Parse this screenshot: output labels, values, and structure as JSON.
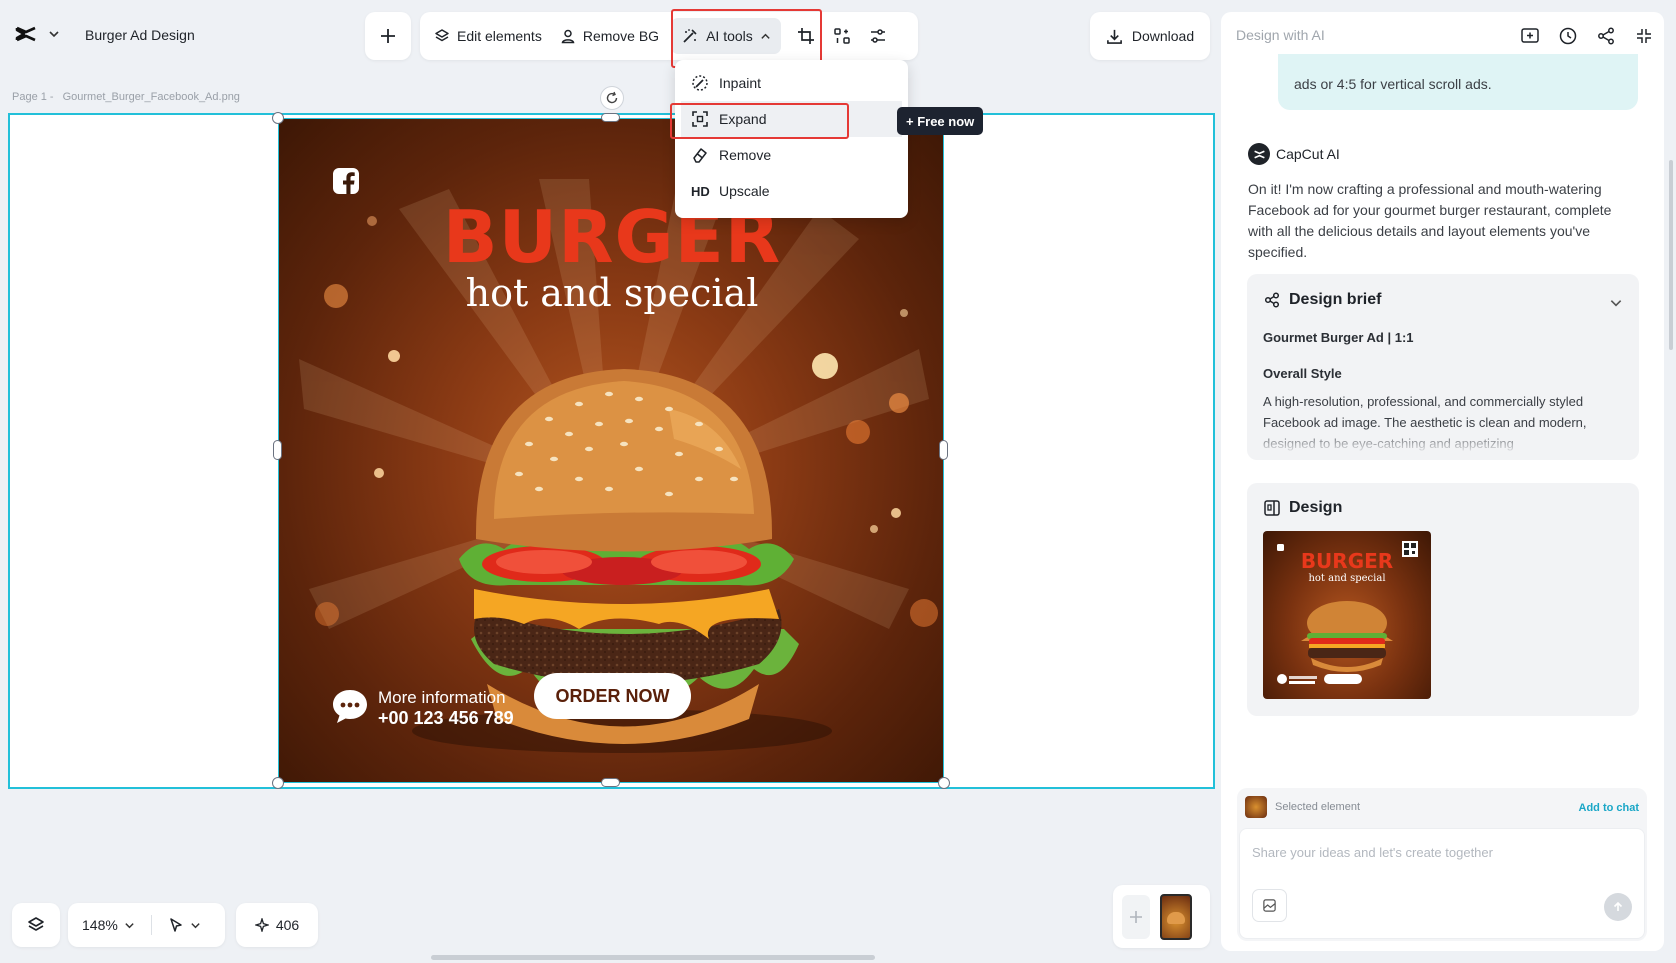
{
  "header": {
    "project_title": "Burger Ad Design",
    "add_label": "+",
    "edit_elements": "Edit elements",
    "remove_bg": "Remove BG",
    "ai_tools": "AI tools",
    "download": "Download"
  },
  "ai_menu": {
    "items": [
      {
        "label": "Inpaint",
        "icon": "inpaint-icon"
      },
      {
        "label": "Expand",
        "icon": "expand-icon"
      },
      {
        "label": "Remove",
        "icon": "eraser-icon"
      },
      {
        "label": "Upscale",
        "icon": "hd-icon",
        "prefix": "HD"
      }
    ],
    "free_badge": "+ Free now"
  },
  "canvas": {
    "page_label": "Page 1 -",
    "file_name": "Gourmet_Burger_Facebook_Ad.png"
  },
  "ad": {
    "headline": "BURGER",
    "subheadline": "hot and special",
    "more_info": "More information",
    "phone": "+00 123 456 789",
    "cta": "ORDER NOW"
  },
  "bottom_bar": {
    "zoom": "148%",
    "credits": "406"
  },
  "side_panel": {
    "placeholder_title": "Design with AI",
    "prev_message": "ads or 4:5 for vertical scroll ads.",
    "assistant_name": "CapCut AI",
    "assistant_message": "On it! I'm now crafting a professional and mouth-watering Facebook ad for your gourmet burger restaurant, complete with all the delicious details and layout elements you've specified.",
    "brief_title": "Design brief",
    "brief_subtitle": "Gourmet Burger Ad | 1:1",
    "brief_section": "Overall Style",
    "brief_text": "A high-resolution, professional, and commercially styled Facebook ad image. The aesthetic is clean and modern, designed to be eye-catching and appetizing",
    "design_title": "Design",
    "selected_element": "Selected element",
    "add_to_chat": "Add to chat",
    "input_placeholder": "Share your ideas and let's create together"
  },
  "colors": {
    "accent": "#e53935",
    "selection": "#22c0d9",
    "link": "#1aa7c7",
    "burger_red": "#e8381b",
    "ad_bg": "#6a2c10"
  }
}
